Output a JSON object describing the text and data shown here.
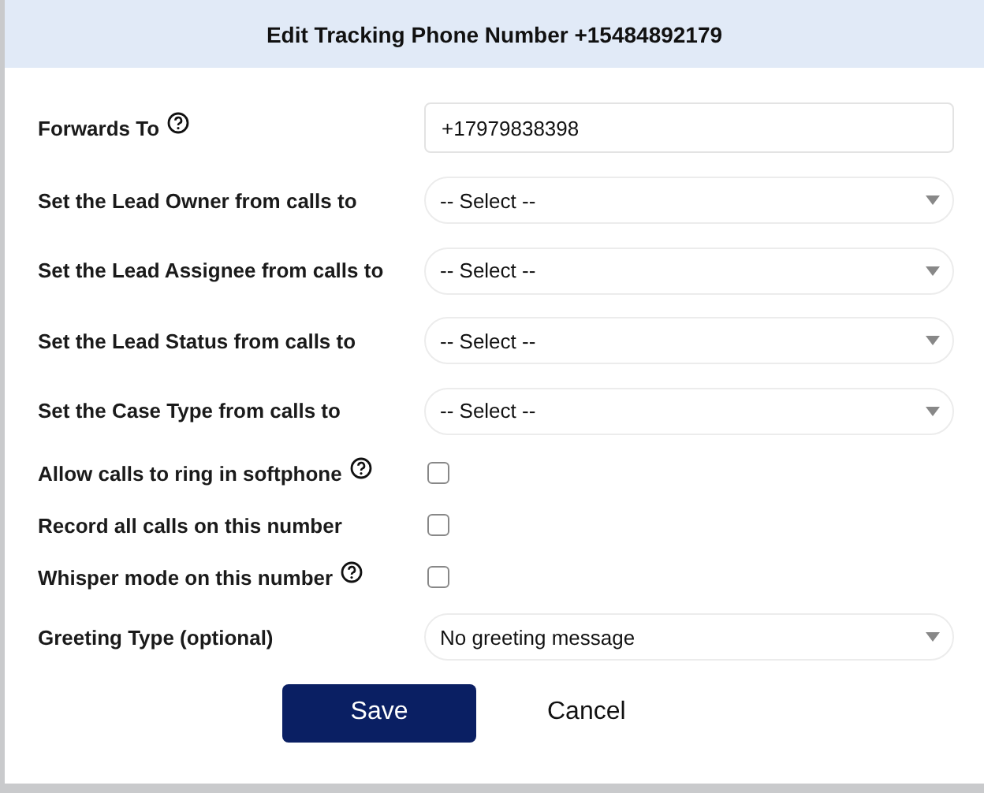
{
  "dialog": {
    "title": "Edit Tracking Phone Number +15484892179"
  },
  "fields": [
    {
      "kind": "text",
      "label": "Forwards To",
      "help": true,
      "value": "+17979838398"
    },
    {
      "kind": "select",
      "label": "Set the Lead Owner from calls to",
      "help": false,
      "value": "-- Select --"
    },
    {
      "kind": "select",
      "label": "Set the Lead Assignee from calls to",
      "help": false,
      "value": "-- Select --"
    },
    {
      "kind": "select",
      "label": "Set the Lead Status from calls to",
      "help": false,
      "value": "-- Select --"
    },
    {
      "kind": "select",
      "label": "Set the Case Type from calls to",
      "help": false,
      "value": "-- Select --"
    },
    {
      "kind": "checkbox",
      "label": "Allow calls to ring in softphone",
      "help": true,
      "checked": false
    },
    {
      "kind": "checkbox",
      "label": "Record all calls on this number",
      "help": false,
      "checked": false
    },
    {
      "kind": "checkbox",
      "label": "Whisper mode on this number",
      "help": true,
      "checked": false
    },
    {
      "kind": "select",
      "label": "Greeting Type (optional)",
      "help": false,
      "value": "No greeting message"
    }
  ],
  "buttons": {
    "save": "Save",
    "cancel": "Cancel"
  }
}
